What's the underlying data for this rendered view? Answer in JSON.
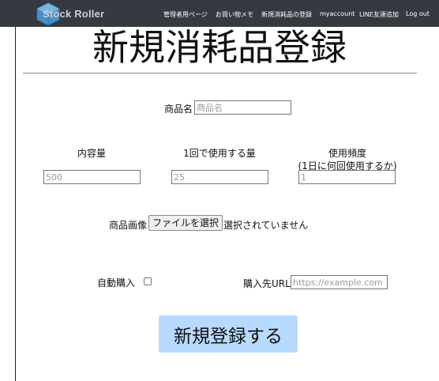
{
  "navbar": {
    "brand": "Stock Roller",
    "links": [
      "管理者用ページ",
      "お買い物メモ",
      "新規消耗品の登録",
      "myaccount",
      "LINE友達追加",
      "Log out"
    ]
  },
  "page": {
    "title": "新規消耗品登録"
  },
  "form": {
    "product_name_label": "商品名",
    "product_name_placeholder": "商品名",
    "content_label": "内容量",
    "content_placeholder": "500",
    "per_use_label": "1回で使用する量",
    "per_use_placeholder": "25",
    "frequency_label": "使用頻度",
    "frequency_sublabel": "(1日に何回使用するか)",
    "frequency_placeholder": "1",
    "image_label": "商品画像",
    "file_button": "ファイルを選択",
    "file_status": "選択されていません",
    "auto_purchase_label": "自動購入",
    "auto_purchase_checked": false,
    "url_label": "購入先URL",
    "url_placeholder": "https://example.com",
    "submit_label": "新規登録する"
  },
  "colors": {
    "navbar": "#343a40",
    "submit": "#b8daff",
    "logo": "#4a90c8"
  }
}
